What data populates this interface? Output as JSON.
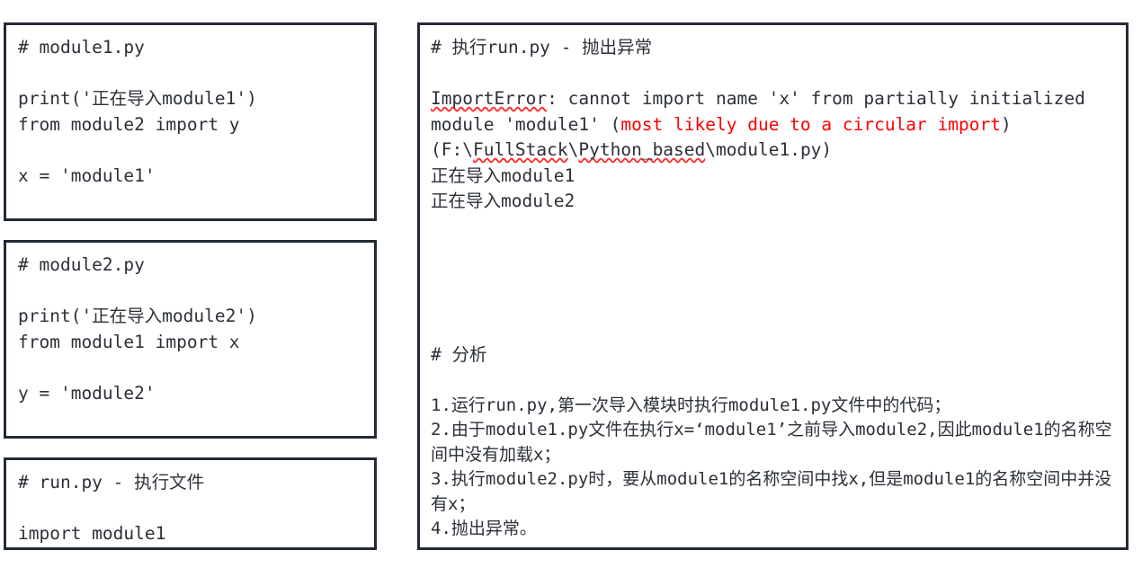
{
  "panels": {
    "module1": {
      "title_comment": "# module1.py",
      "lines": [
        "print('正在导入module1')",
        "from module2 import y",
        "",
        "x = 'module1'"
      ],
      "body": "print('正在导入module1')\nfrom module2 import y\n\nx = 'module1'"
    },
    "module2": {
      "title_comment": "# module2.py",
      "lines": [
        "print('正在导入module2')",
        "from module1 import x",
        "",
        "y = 'module2'"
      ],
      "body": "print('正在导入module2')\nfrom module1 import x\n\ny = 'module2'"
    },
    "runpy": {
      "title_comment": "# run.py - 执行文件",
      "body": "import module1"
    },
    "output": {
      "title_comment": "# 执行run.py - 抛出异常",
      "error": {
        "exception_name": "ImportError",
        "segment_1": ": cannot import name 'x' from partially initialized module 'module1' (",
        "segment_red": "most likely due to a circular import",
        "segment_2": ") (F:\\",
        "path_underlined_1": "FullStack",
        "path_sep": "\\",
        "path_underlined_2": "Python_based",
        "path_tail": "\\module1.py)",
        "full_text": "ImportError: cannot import name 'x' from partially initialized module 'module1' (most likely due to a circular import) (F:\\FullStack\\Python_based\\module1.py)"
      },
      "stdout": [
        "正在导入module1",
        "正在导入module2"
      ],
      "analysis_heading": "# 分析",
      "analysis_items": [
        "1.运行run.py,第一次导入模块时执行module1.py文件中的代码；",
        "2.由于module1.py文件在执行x=‘module1’之前导入module2,因此module1的名称空间中没有加载x；",
        "3.执行module2.py时，要从module1的名称空间中找x,但是module1的名称空间中并没有x；",
        "4.抛出异常。"
      ]
    }
  },
  "colors": {
    "border": "#232a35",
    "text": "#2b3038",
    "error_red": "#ff0000",
    "spellcheck_squiggle": "#ff2d2d",
    "background": "#ffffff"
  }
}
